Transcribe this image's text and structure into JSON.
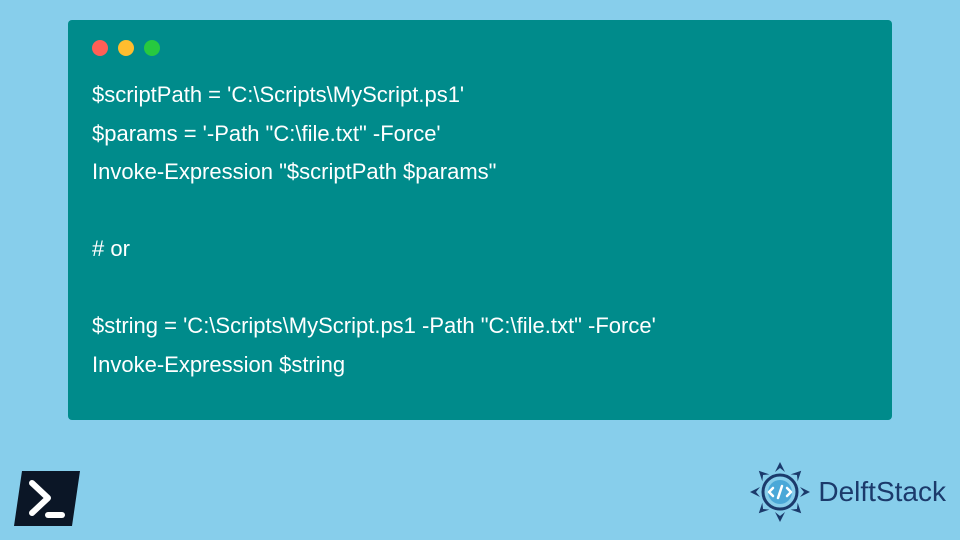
{
  "code": {
    "lines": [
      "$scriptPath = 'C:\\Scripts\\MyScript.ps1'",
      "$params = '-Path \"C:\\file.txt\" -Force'",
      "Invoke-Expression \"$scriptPath $params\"",
      "",
      "# or",
      "",
      "$string = 'C:\\Scripts\\MyScript.ps1 -Path \"C:\\file.txt\" -Force'",
      "Invoke-Expression $string"
    ]
  },
  "brand": {
    "name": "DelftStack"
  },
  "icons": {
    "powershell": "powershell-icon",
    "brand_logo": "delftstack-logo"
  },
  "colors": {
    "page_bg": "#87ceeb",
    "window_bg": "#008b8b",
    "code_text": "#ffffff",
    "brand_text": "#1b3a6b",
    "dot_red": "#ff5f56",
    "dot_yellow": "#ffbd2e",
    "dot_green": "#27c93f"
  }
}
